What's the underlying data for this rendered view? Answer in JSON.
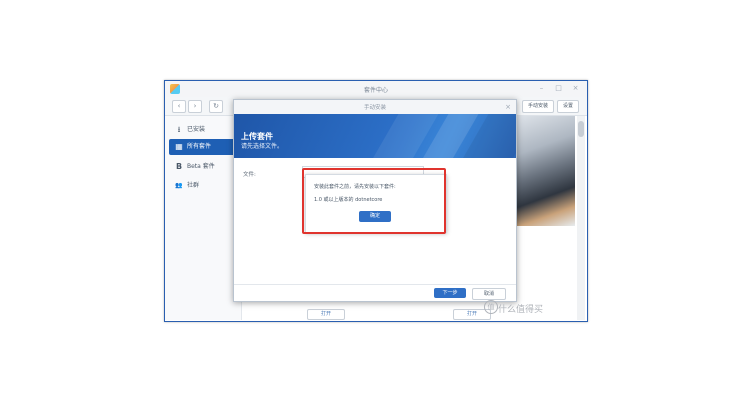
{
  "window": {
    "title": "套件中心",
    "back_icon": "‹",
    "forward_icon": "›",
    "refresh_icon": "↻",
    "manual_install_label": "手动安装",
    "settings_label": "设置",
    "minimize_icon": "–",
    "maximize_icon": "□",
    "close_icon": "×"
  },
  "sidebar": {
    "items": [
      {
        "label": "已安装",
        "icon": "download-icon",
        "glyph": "⭳"
      },
      {
        "label": "所有套件",
        "icon": "grid-icon",
        "glyph": "▦"
      },
      {
        "label": "Beta 套件",
        "icon": "beta-icon",
        "glyph": "B"
      },
      {
        "label": "社群",
        "icon": "community-icon",
        "glyph": "👥"
      }
    ]
  },
  "background": {
    "open_label": "打开"
  },
  "dialog": {
    "title": "手动安装",
    "close_icon": "×",
    "banner_title": "上传套件",
    "banner_subtitle": "请先选择文件。",
    "file_label": "文件:",
    "next_label": "下一步",
    "cancel_label": "取消"
  },
  "alert": {
    "line1": "安装此套件之前，请先安装以下套件:",
    "line2": "1.0 或以上版本的 dotnetcore",
    "ok_label": "确定"
  },
  "watermark": {
    "logo": "值",
    "text": "什么值得买"
  },
  "colors": {
    "accent": "#1e5fb4",
    "highlight": "#e0342e"
  }
}
